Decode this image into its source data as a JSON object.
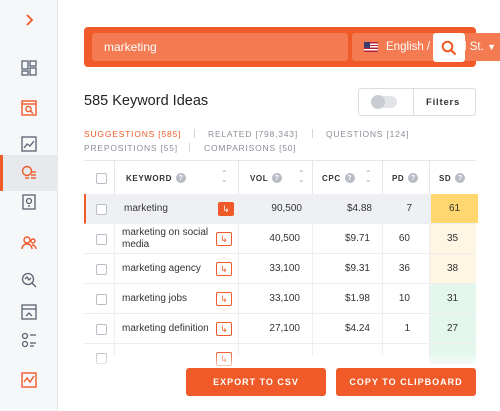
{
  "colors": {
    "accent": "#f05a28",
    "sd_easy": "#e4f7ec",
    "sd_medium": "#fff5e3",
    "sd_hard": "#ffd76e"
  },
  "sidebar": {
    "items": [
      {
        "icon": "chevron-right-icon"
      },
      {
        "icon": "dashboard-icon"
      },
      {
        "icon": "site-audit-icon"
      },
      {
        "icon": "traffic-chart-icon"
      },
      {
        "icon": "keyword-ideas-icon",
        "active": true
      },
      {
        "icon": "content-ideas-icon"
      },
      {
        "icon": "backlinks-icon"
      },
      {
        "icon": "domain-overview-icon"
      },
      {
        "icon": "page-analysis-icon"
      },
      {
        "icon": "search-results-icon"
      },
      {
        "icon": "rank-tracking-icon"
      }
    ]
  },
  "search": {
    "query": "marketing",
    "language": "English / United St..."
  },
  "results": {
    "title": "585 Keyword Ideas",
    "filters_label": "Filters"
  },
  "tabs": [
    {
      "label": "SUGGESTIONS [585]",
      "active": true
    },
    {
      "label": "RELATED [798,343]"
    },
    {
      "label": "QUESTIONS [124]"
    },
    {
      "label": "PREPOSITIONS [55]"
    },
    {
      "label": "COMPARISONS [50]"
    }
  ],
  "table": {
    "headers": {
      "keyword": "KEYWORD",
      "vol": "VOL",
      "cpc": "CPC",
      "pd": "PD",
      "sd": "SD"
    },
    "rows": [
      {
        "keyword": "marketing",
        "vol": "90,500",
        "cpc": "$4.88",
        "pd": "7",
        "sd": "61",
        "sd_color": "#ffd76e",
        "highlight": true
      },
      {
        "keyword": "marketing on social media",
        "vol": "40,500",
        "cpc": "$9.71",
        "pd": "60",
        "sd": "35",
        "sd_color": "#fff5e3"
      },
      {
        "keyword": "marketing agency",
        "vol": "33,100",
        "cpc": "$9.31",
        "pd": "36",
        "sd": "38",
        "sd_color": "#fff5e3"
      },
      {
        "keyword": "marketing jobs",
        "vol": "33,100",
        "cpc": "$1.98",
        "pd": "10",
        "sd": "31",
        "sd_color": "#e4f7ec"
      },
      {
        "keyword": "marketing definition",
        "vol": "27,100",
        "cpc": "$4.24",
        "pd": "1",
        "sd": "27",
        "sd_color": "#e4f7ec"
      }
    ]
  },
  "actions": {
    "export_csv": "EXPORT TO CSV",
    "copy_clipboard": "COPY TO CLIPBOARD"
  }
}
